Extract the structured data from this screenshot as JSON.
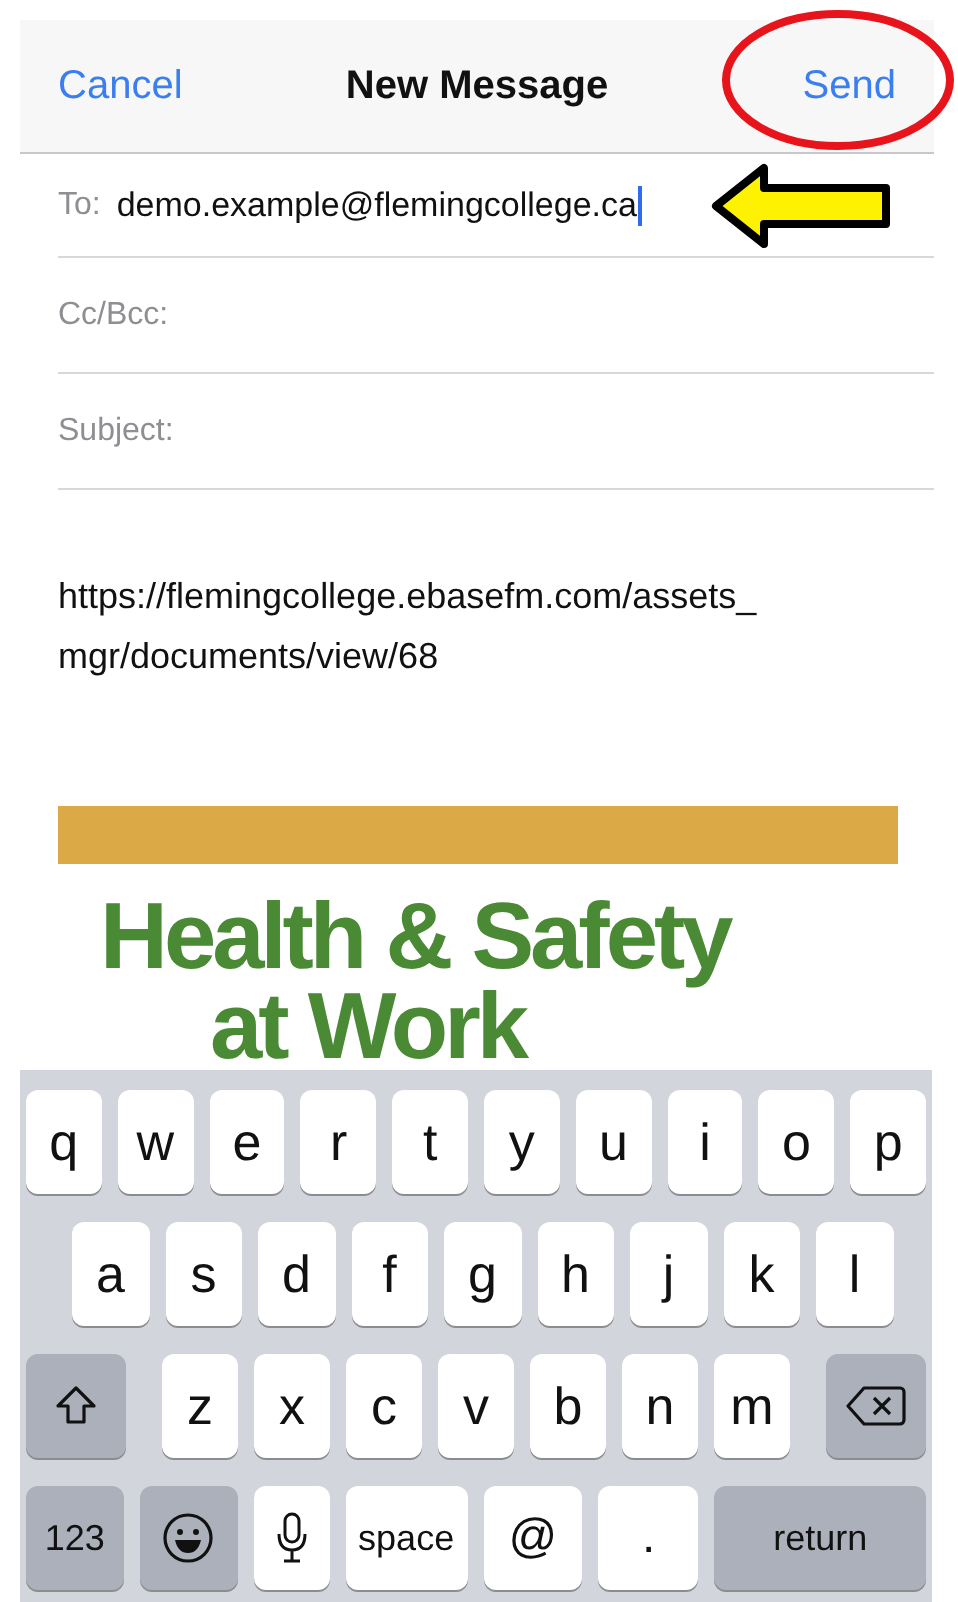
{
  "nav": {
    "cancel": "Cancel",
    "title": "New Message",
    "send": "Send"
  },
  "fields": [
    {
      "label": "To:",
      "value": "demo.example@flemingcollege.ca",
      "focused": true
    },
    {
      "label": "Cc/Bcc:"
    },
    {
      "label": "Subject:"
    }
  ],
  "body": {
    "text": "https://flemingcollege.ebasefm.com/assets_ mgr/documents/view/68"
  },
  "attachment": {
    "heading": [
      "Health & Safety",
      "at Work"
    ]
  },
  "keyboard": {
    "rows": [
      {
        "keys": [
          {
            "kind": "letter",
            "label": "q"
          },
          {
            "kind": "letter",
            "label": "w"
          },
          {
            "kind": "letter",
            "label": "e"
          },
          {
            "kind": "letter",
            "label": "r"
          },
          {
            "kind": "letter",
            "label": "t"
          },
          {
            "kind": "letter",
            "label": "y"
          },
          {
            "kind": "letter",
            "label": "u"
          },
          {
            "kind": "letter",
            "label": "i"
          },
          {
            "kind": "letter",
            "label": "o"
          },
          {
            "kind": "letter",
            "label": "p"
          }
        ]
      },
      {
        "keys": [
          {
            "kind": "letter",
            "label": "a"
          },
          {
            "kind": "letter",
            "label": "s"
          },
          {
            "kind": "letter",
            "label": "d"
          },
          {
            "kind": "letter",
            "label": "f"
          },
          {
            "kind": "letter",
            "label": "g"
          },
          {
            "kind": "letter",
            "label": "h"
          },
          {
            "kind": "letter",
            "label": "j"
          },
          {
            "kind": "letter",
            "label": "k"
          },
          {
            "kind": "letter",
            "label": "l"
          }
        ]
      },
      {
        "keys": [
          {
            "kind": "shift"
          },
          {
            "kind": "letter",
            "label": "z"
          },
          {
            "kind": "letter",
            "label": "x"
          },
          {
            "kind": "letter",
            "label": "c"
          },
          {
            "kind": "letter",
            "label": "v"
          },
          {
            "kind": "letter",
            "label": "b"
          },
          {
            "kind": "letter",
            "label": "n"
          },
          {
            "kind": "letter",
            "label": "m"
          },
          {
            "kind": "delete"
          }
        ]
      },
      {
        "keys": [
          {
            "kind": "numbers",
            "label": "123"
          },
          {
            "kind": "emoji"
          },
          {
            "kind": "mic"
          },
          {
            "kind": "space",
            "label": "space"
          },
          {
            "kind": "symbol",
            "label": "@"
          },
          {
            "kind": "symbol",
            "label": "."
          },
          {
            "kind": "return",
            "label": "return"
          }
        ]
      }
    ]
  },
  "annotations": {
    "send_circled": true,
    "recipient_arrow": true
  }
}
